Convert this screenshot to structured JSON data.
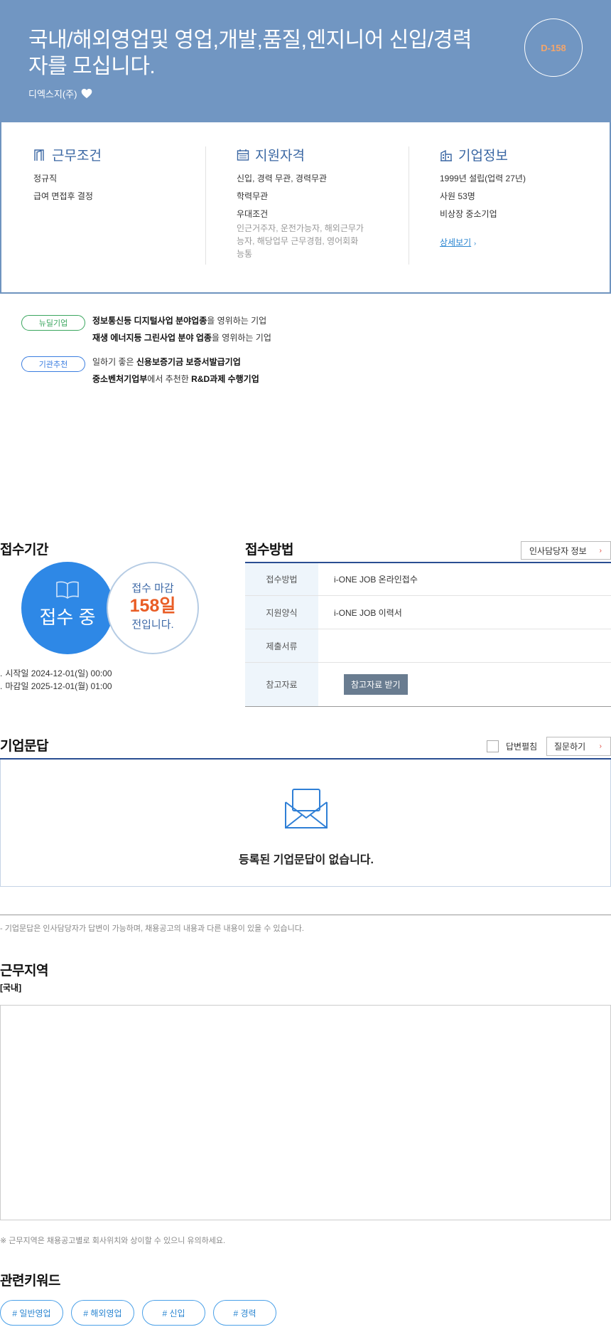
{
  "header": {
    "title": "국내/해외영업및 영업,개발,품질,엔지니어 신입/경력자를 모십니다.",
    "company": "디엑스지(주)",
    "dday": "D-158"
  },
  "summary": {
    "conditions": {
      "heading": "근무조건",
      "lines": [
        "정규직",
        "급여 면접후 결정"
      ]
    },
    "qualification": {
      "heading": "지원자격",
      "lines": [
        "신입, 경력 무관, 경력무관",
        "학력무관",
        "우대조건"
      ],
      "preference": "인근거주자, 운전가능자, 해외근무가능자, 해당업무 근무경험, 영어회화능통"
    },
    "company_info": {
      "heading": "기업정보",
      "lines": [
        "1999년 설립(업력 27년)",
        "사원 53명",
        "비상장 중소기업"
      ],
      "detail_link": "상세보기"
    }
  },
  "badges": [
    {
      "label": "뉴딜기업",
      "lines": [
        {
          "bold": "정보통신등 디지털사업 분야업종",
          "rest": "을 영위하는 기업"
        },
        {
          "bold": "재생 에너지등 그린사업 분야 업종",
          "rest": "을 영위하는 기업"
        }
      ]
    },
    {
      "label": "기관추천",
      "lines": [
        {
          "pre": "일하기 좋은 ",
          "bold": "신용보증기금 보증서발급기업",
          "rest": ""
        },
        {
          "bold": "중소벤처기업부",
          "rest": "에서 추천한 ",
          "bold2": "R&D과제 수행기업"
        }
      ]
    }
  ],
  "receipt": {
    "heading": "접수기간",
    "status": "접수 중",
    "deadline_prefix": "접수 마감",
    "deadline_days": "158일",
    "deadline_suffix": "전입니다.",
    "start": "시작일 2024-12-01(일) 00:00",
    "end": "마감일 2025-12-01(월) 01:00"
  },
  "method": {
    "heading": "접수방법",
    "hr_button": "인사담당자 정보",
    "rows": [
      {
        "key": "접수방법",
        "value": "i-ONE JOB 온라인접수"
      },
      {
        "key": "지원양식",
        "value": "i-ONE JOB 이력서"
      },
      {
        "key": "제출서류",
        "value": ""
      },
      {
        "key": "참고자료",
        "button": "참고자료 받기"
      }
    ]
  },
  "qna": {
    "heading": "기업문답",
    "answer_toggle": "답변펼침",
    "ask_button": "질문하기",
    "empty": "등록된 기업문답이 없습니다.",
    "note": "- 기업문답은 인사담당자가 답변이 가능하며, 채용공고의 내용과 다른 내용이 있을 수 있습니다."
  },
  "work_area": {
    "heading": "근무지역",
    "region": "[국내]",
    "note": "※ 근무지역은 채용공고별로 회사위치와 상이할 수 있으니 유의하세요."
  },
  "keywords": {
    "heading": "관련키워드",
    "items": [
      "# 일반영업",
      "# 해외영업",
      "# 신입",
      "# 경력"
    ]
  }
}
